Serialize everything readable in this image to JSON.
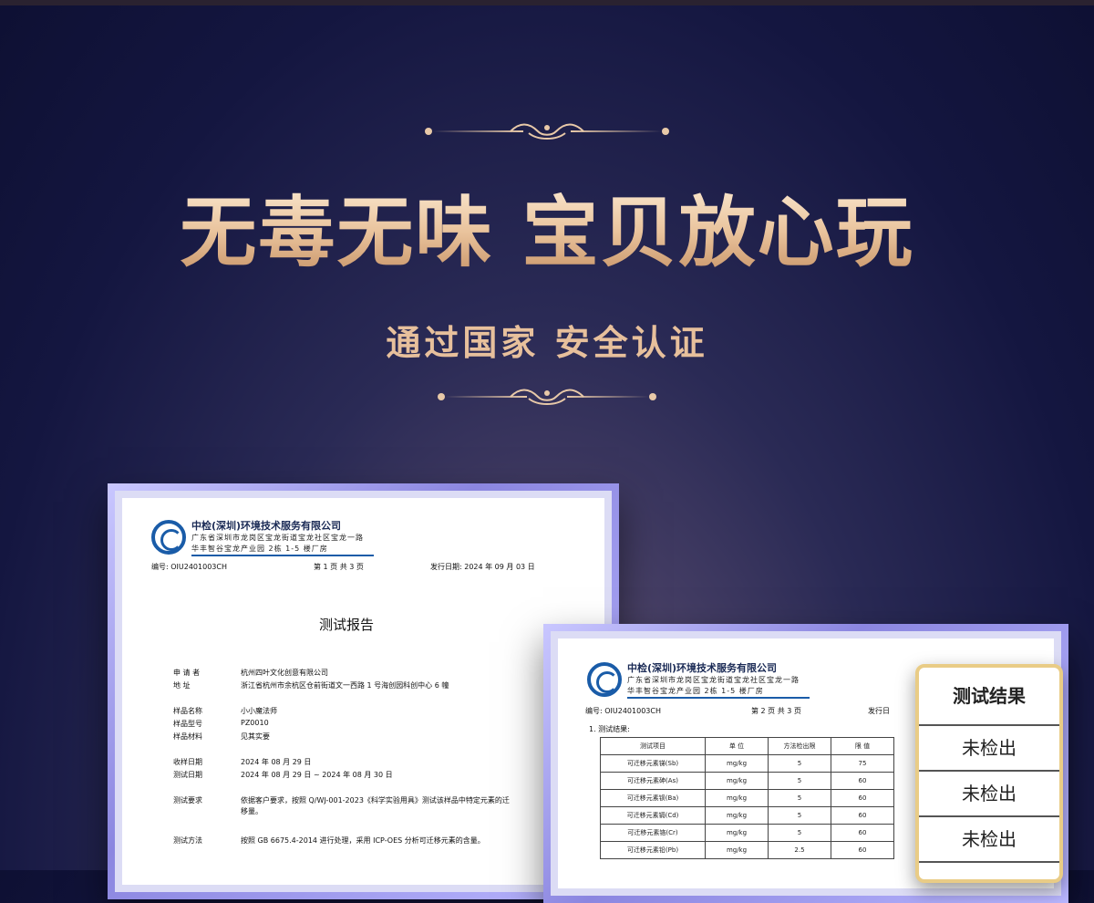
{
  "headline": "无毒无味 宝贝放心玩",
  "subline": "通过国家 安全认证",
  "ornament_icon": "scroll-flourish-icon",
  "colors": {
    "gold": "#e8c9a8",
    "navy": "#141640",
    "frame": "#8b86e0",
    "card_border": "#e9cc86"
  },
  "cert1": {
    "org": "中检(深圳)环境技术服务有限公司",
    "addr1": "广东省深圳市龙岗区宝龙街道宝龙社区宝龙一路",
    "addr2": "华丰智谷宝龙产业园 2栋 1-5 楼厂房",
    "report_no": "编号: OIU2401003CH",
    "page": "第 1 页 共 3 页",
    "date": "发行日期: 2024 年 09 月 03 日",
    "title": "测试报告",
    "fields": [
      {
        "k": "申 请 者",
        "v": "杭州四叶文化创意有限公司"
      },
      {
        "k": "地    址",
        "v": "浙江省杭州市余杭区仓前街道文一西路 1 号海创园科创中心 6 幢"
      },
      {
        "k": "样品名称",
        "v": "小小魔法师"
      },
      {
        "k": "样品型号",
        "v": "PZ0010"
      },
      {
        "k": "样品材料",
        "v": "见其实要"
      },
      {
        "k": "收样日期",
        "v": "2024 年 08 月 29 日"
      },
      {
        "k": "测试日期",
        "v": "2024 年 08 月 29 日 ~ 2024 年 08 月 30 日"
      },
      {
        "k": "测试要求",
        "v": "依据客户要求，按照 Q/WJ-001-2023《科学实验用具》测试该样品中特定元素的迁移量。"
      },
      {
        "k": "测试方法",
        "v": "按照 GB 6675.4-2014 进行处理，采用 ICP-OES 分析可迁移元素的含量。"
      }
    ]
  },
  "cert2": {
    "org": "中检(深圳)环境技术服务有限公司",
    "addr1": "广东省深圳市龙岗区宝龙街道宝龙社区宝龙一路",
    "addr2": "华丰智谷宝龙产业园 2栋 1-5 楼厂房",
    "report_no": "编号: OIU2401003CH",
    "page": "第 2 页 共 3 页",
    "date": "发行日",
    "section": "1.  测试结果:",
    "headers": [
      "测试项目",
      "单 位",
      "方法检出限",
      "限 值"
    ],
    "rows": [
      [
        "可迁移元素锑(Sb)",
        "mg/kg",
        "5",
        "75"
      ],
      [
        "可迁移元素砷(As)",
        "mg/kg",
        "5",
        "60"
      ],
      [
        "可迁移元素钡(Ba)",
        "mg/kg",
        "5",
        "60"
      ],
      [
        "可迁移元素镉(Cd)",
        "mg/kg",
        "5",
        "60"
      ],
      [
        "可迁移元素铬(Cr)",
        "mg/kg",
        "5",
        "60"
      ],
      [
        "可迁移元素铅(Pb)",
        "mg/kg",
        "2.5",
        "60"
      ]
    ]
  },
  "result_card": {
    "title": "测试结果",
    "values": [
      "未检出",
      "未检出",
      "未检出"
    ]
  }
}
